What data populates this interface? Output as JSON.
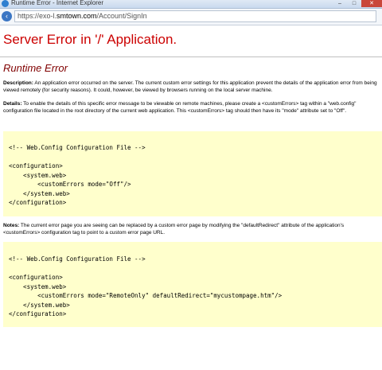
{
  "window": {
    "title": "Runtime Error - Internet Explorer",
    "minimize": "–",
    "maximize": "□",
    "close": "✕"
  },
  "address_bar": {
    "url_prefix": "https://exo-l.",
    "url_domain": "smtown.com",
    "url_path": "/Account/SignIn"
  },
  "page": {
    "heading": "Server Error in '/' Application.",
    "subheading": "Runtime Error",
    "description_label": "Description:",
    "description_text": " An application error occurred on the server. The current custom error settings for this application prevent the details of the application error from being viewed remotely (for security reasons). It could, however, be viewed by browsers running on the local server machine.",
    "details_label": "Details:",
    "details_text": " To enable the details of this specific error message to be viewable on remote machines, please create a <customErrors> tag within a \"web.config\" configuration file located in the root directory of the current web application. This <customErrors> tag should then have its \"mode\" attribute set to \"Off\".",
    "code_block_1": "<!-- Web.Config Configuration File -->\n\n<configuration>\n    <system.web>\n        <customErrors mode=\"Off\"/>\n    </system.web>\n</configuration>",
    "notes_label": "Notes:",
    "notes_text": " The current error page you are seeing can be replaced by a custom error page by modifying the \"defaultRedirect\" attribute of the application's <customErrors> configuration tag to point to a custom error page URL.",
    "code_block_2": "<!-- Web.Config Configuration File -->\n\n<configuration>\n    <system.web>\n        <customErrors mode=\"RemoteOnly\" defaultRedirect=\"mycustompage.htm\"/>\n    </system.web>\n</configuration>"
  },
  "colors": {
    "heading": "#cc0000",
    "subheading": "#800000",
    "code_background": "#ffffcc"
  }
}
